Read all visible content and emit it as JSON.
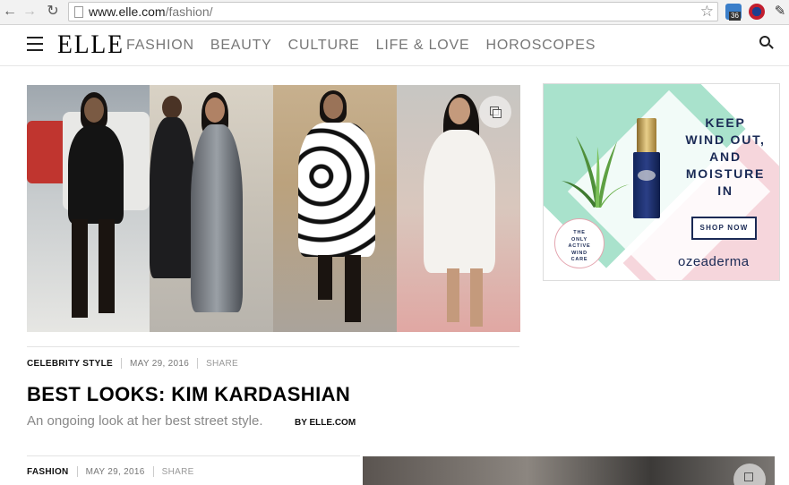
{
  "browser": {
    "url_host": "www.elle.com",
    "url_path": "/fashion/",
    "extension_badge": "36"
  },
  "site": {
    "logo": "ELLE",
    "nav": [
      "FASHION",
      "BEAUTY",
      "CULTURE",
      "LIFE & LOVE",
      "HOROSCOPES"
    ]
  },
  "feature": {
    "category": "CELEBRITY STYLE",
    "date": "MAY 29, 2016",
    "share": "SHARE",
    "headline": "BEST LOOKS: KIM KARDASHIAN",
    "dek": "An ongoing look at her best street style.",
    "byline": "BY ELLE.COM"
  },
  "second_article": {
    "category": "FASHION",
    "date": "MAY 29, 2016",
    "share": "SHARE"
  },
  "ad": {
    "headline_lines": [
      "KEEP",
      "WIND OUT,",
      "AND",
      "MOISTURE",
      "IN"
    ],
    "cta": "SHOP NOW",
    "seal_lines": [
      "THE",
      "ONLY",
      "ACTIVE",
      "WIND",
      "CARE"
    ],
    "brand": "ozeaderma",
    "colors": {
      "navy": "#1a2a55",
      "mint": "#a9e2cc",
      "pink": "#f6d6dc"
    }
  },
  "icons": {
    "back": "arrow-left-icon",
    "forward": "arrow-right-icon",
    "reload": "reload-icon",
    "bookmark": "star-icon",
    "menu": "hamburger-icon",
    "search": "search-icon",
    "gallery": "gallery-icon"
  }
}
